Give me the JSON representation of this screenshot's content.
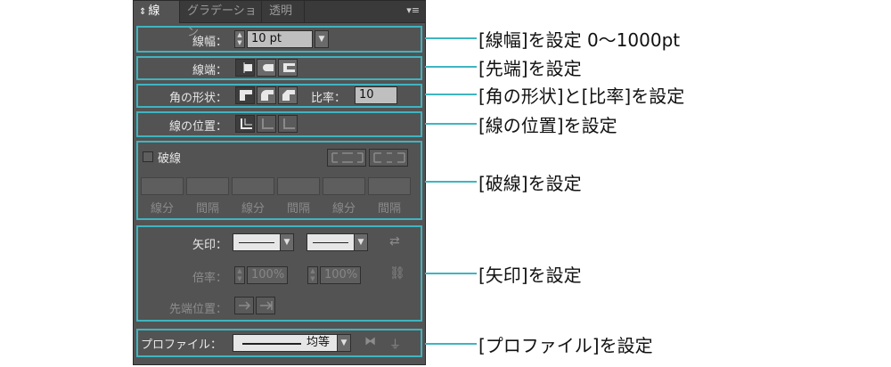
{
  "tabs": [
    {
      "label": "線",
      "active": true
    },
    {
      "label": "グラデーション",
      "active": false
    },
    {
      "label": "透明",
      "active": false
    }
  ],
  "menu_icon": "panel-menu-icon",
  "stroke_weight": {
    "label": "線幅：",
    "value": "10 pt"
  },
  "cap": {
    "label": "線端："
  },
  "corner": {
    "label": "角の形状：",
    "limit_label": "比率：",
    "limit_value": "10"
  },
  "align": {
    "label": "線の位置："
  },
  "dashed": {
    "label": "破線",
    "fields": [
      {
        "label": "線分"
      },
      {
        "label": "間隔"
      },
      {
        "label": "線分"
      },
      {
        "label": "間隔"
      },
      {
        "label": "線分"
      },
      {
        "label": "間隔"
      }
    ]
  },
  "arrows": {
    "label": "矢印：",
    "scale_label": "倍率：",
    "scale_start": "100%",
    "scale_end": "100%",
    "align_label": "先端位置："
  },
  "profile": {
    "label": "プロファイル：",
    "value": "均等"
  },
  "annotations": [
    "[線幅]を設定 0〜1000pt",
    "[先端]を設定",
    "[角の形状]と[比率]を設定",
    "[線の位置]を設定",
    "[破線]を設定",
    "[矢印]を設定",
    "[プロファイル]を設定"
  ],
  "colors": {
    "panel_bg": "#535353",
    "highlight": "#3fb4c0",
    "tabbar_bg": "#3a3a3a"
  }
}
